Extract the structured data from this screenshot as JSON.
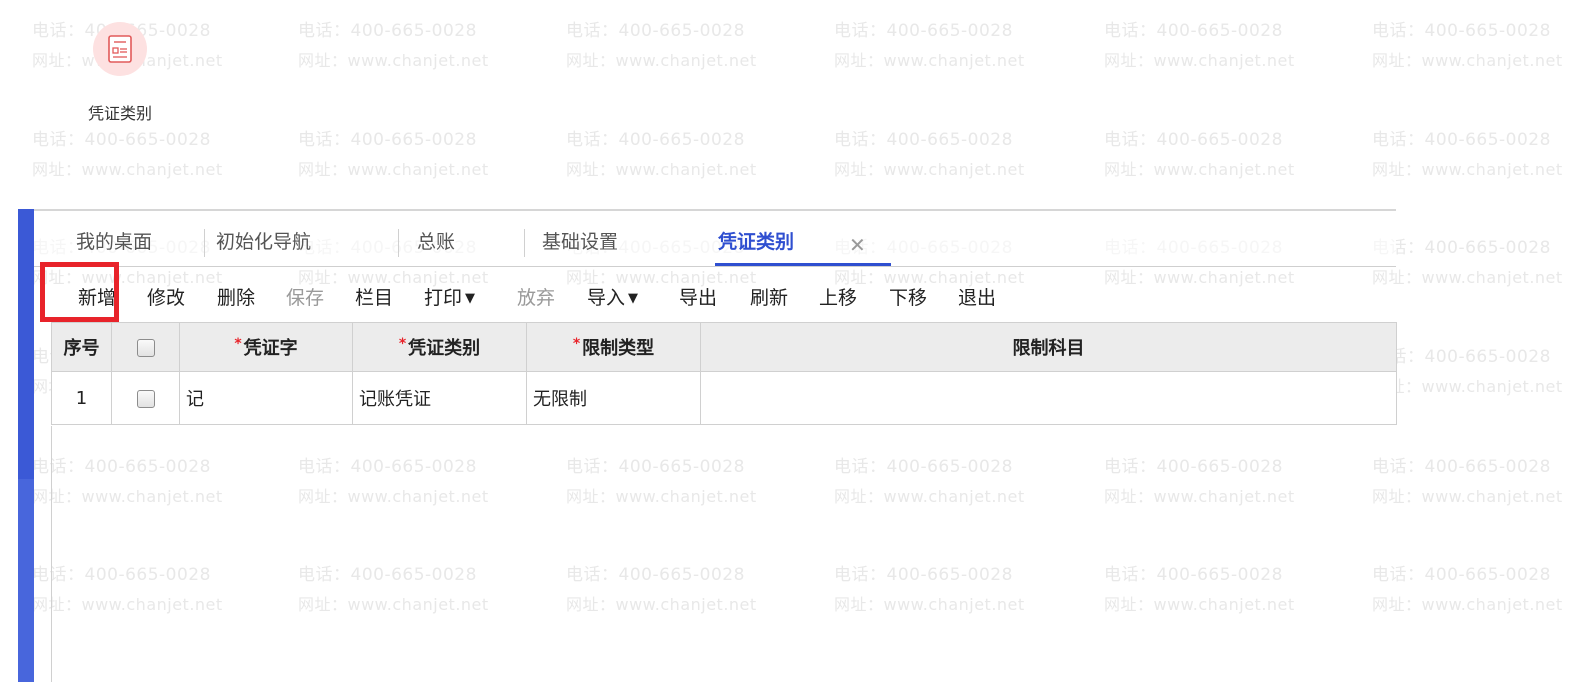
{
  "watermark": {
    "line1": "电话：400-665-0028",
    "line2": "网址：www.chanjet.net"
  },
  "desktop": {
    "icon_label": "凭证类别"
  },
  "tabs": [
    {
      "label": "我的桌面",
      "active": false
    },
    {
      "label": "初始化导航",
      "active": false
    },
    {
      "label": "总账",
      "active": false
    },
    {
      "label": "基础设置",
      "active": false
    },
    {
      "label": "凭证类别",
      "active": true
    }
  ],
  "toolbar": {
    "add": "新增",
    "edit": "修改",
    "delete": "删除",
    "save": "保存",
    "columns": "栏目",
    "print": "打印",
    "discard": "放弃",
    "import": "导入",
    "export": "导出",
    "refresh": "刷新",
    "move_up": "上移",
    "move_down": "下移",
    "exit": "退出"
  },
  "grid": {
    "headers": {
      "seq": "序号",
      "voucher_char": "凭证字",
      "voucher_type": "凭证类别",
      "restrict_type": "限制类型",
      "restrict_subject": "限制科目"
    },
    "rows": [
      {
        "seq": "1",
        "voucher_char": "记",
        "voucher_type": "记账凭证",
        "restrict_type": "无限制",
        "restrict_subject": ""
      }
    ]
  },
  "colors": {
    "accent": "#2f4fd0",
    "left_bar": "#3b59d6",
    "highlight": "#e8232a",
    "required": "#e8232a"
  }
}
